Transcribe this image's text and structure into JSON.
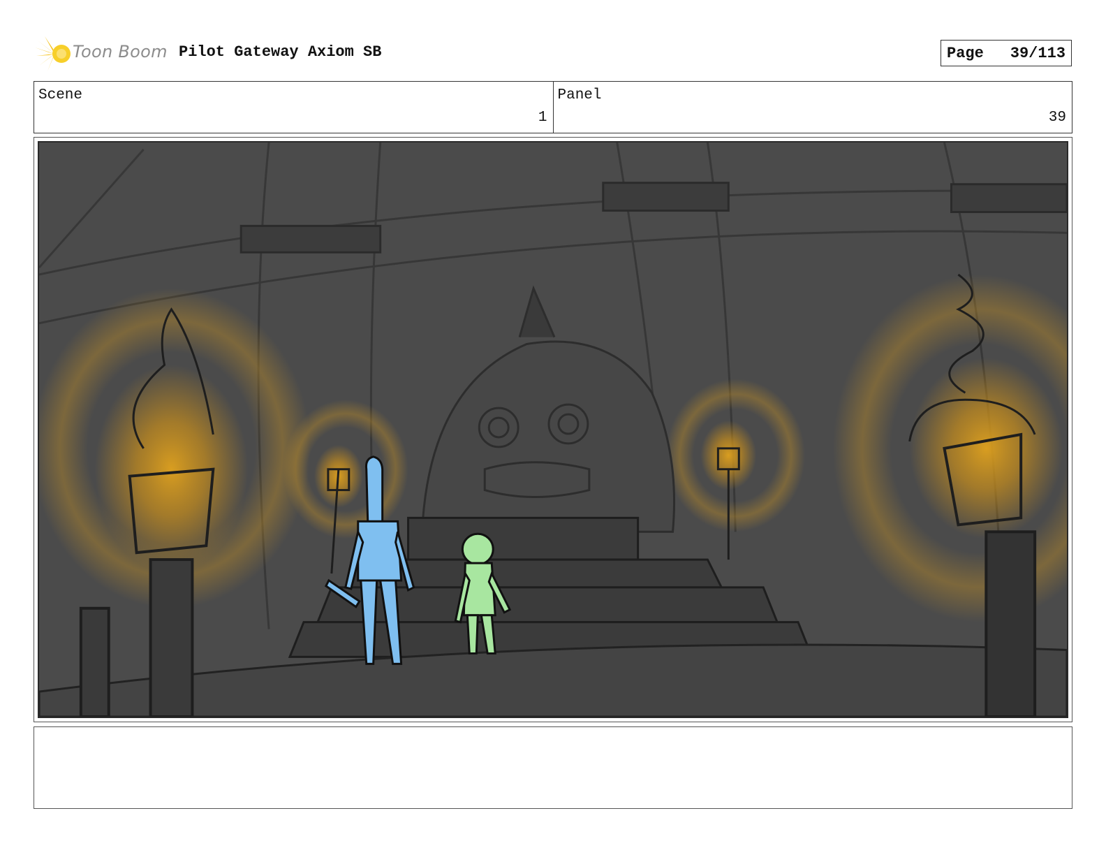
{
  "header": {
    "logo_text": "Toon Boom",
    "project_title": "Pilot Gateway Axiom SB",
    "page_label": "Page",
    "page_number": "39/113"
  },
  "scene": {
    "label": "Scene",
    "value": "1"
  },
  "panel": {
    "label": "Panel",
    "value": "39"
  },
  "colors": {
    "character_blue": "#7fbff0",
    "character_green": "#a8e6a0",
    "torch_glow": "#e0a21e",
    "background_gray": "#4a4a4a"
  },
  "notes": {
    "text": ""
  }
}
